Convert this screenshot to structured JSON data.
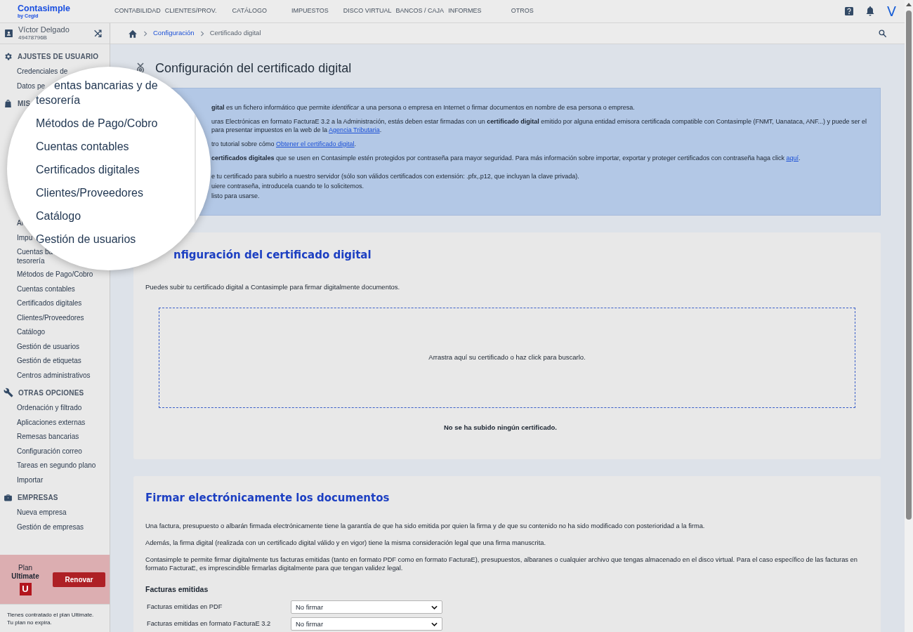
{
  "header": {
    "logo": "Contasimple",
    "logo_sub": "by Cegid",
    "nav": [
      "CONTABILIDAD",
      "CLIENTES/PROV.",
      "CATÁLOGO",
      "IMPUESTOS",
      "DISCO VIRTUAL",
      "BANCOS / CAJA",
      "INFORMES",
      "OTROS"
    ],
    "user_initial": "V"
  },
  "sidebar": {
    "user": {
      "name": "Víctor Delgado",
      "id": "49478796B"
    },
    "sections": [
      {
        "heading": "AJUSTES DE USUARIO",
        "kind": "settings",
        "items": [
          "Credenciales de",
          "Datos pe"
        ]
      },
      {
        "heading": "MIS",
        "kind": "bag"
      },
      {
        "items": [
          "Al",
          "Impu",
          "Cuentas ba\ntesorería",
          "Métodos de Pago/Cobro",
          "Cuentas contables",
          "Certificados digitales",
          "Clientes/Proveedores",
          "Catálogo",
          "Gestión de usuarios",
          "Gestión de etiquetas",
          "Centros administrativos"
        ]
      },
      {
        "heading": "OTRAS OPCIONES",
        "kind": "wrench",
        "items": [
          "Ordenación y filtrado",
          "Aplicaciones externas",
          "Remesas bancarias",
          "Configuración correo",
          "Tareas en segundo plano",
          "Importar"
        ]
      },
      {
        "heading": "EMPRESAS",
        "kind": "briefcase",
        "items": [
          "Nueva empresa",
          "Gestión de empresas"
        ]
      }
    ],
    "plan": {
      "label": "Plan",
      "name": "Ultimate",
      "badge": "U",
      "button": "Renovar"
    },
    "footer": "Tienes contratado el plan Ultimate.\nTu plan no expira."
  },
  "magnifier": {
    "items": [
      "entas bancarias y de",
      "tesorería",
      "Métodos de Pago/Cobro",
      "Cuentas contables",
      "Certificados digitales",
      "Clientes/Proveedores",
      "Catálogo",
      "Gestión de usuarios"
    ]
  },
  "breadcrumb": [
    {
      "label": "Configuración",
      "link": true
    },
    {
      "label": "Certificado digital",
      "link": false
    }
  ],
  "title": "Configuración del certificado digital",
  "info": {
    "paragraphs": [
      [
        {
          "text": "**gital** es un fichero informático que permite *identificar* a una persona o empresa en Internet o firmar documentos en nombre de esa persona o empresa.",
          "link": false
        }
      ],
      [
        {
          "text": "uras Electrónicas en formato FacturaE 3.2 a la Administración, estás deben estar firmadas con un **certificado digital** emitido por alguna entidad emisora certificada compatible con Contasimple (FNMT, Uanataca, ANF...) y puede ser el para presentar impuestos en la web de la ",
          "link": false
        },
        {
          "text": "Agencia Tributaria",
          "link": true
        },
        {
          "text": ".",
          "link": false
        }
      ],
      [
        {
          "text": "tro tutorial sobre cómo ",
          "link": false
        },
        {
          "text": "Obtener el certificado digital",
          "link": true
        },
        {
          "text": ".",
          "link": false
        }
      ],
      [
        {
          "text": "**certificados digitales** que se usen en Contasimple estén protegidos por contraseña para mayor seguridad. Para más información sobre importar, exportar y proteger certificados con contraseña haga click ",
          "link": false
        },
        {
          "text": "aquí",
          "link": true
        },
        {
          "text": ".",
          "link": false
        }
      ]
    ],
    "steps": [
      "e tu certificado para subirlo a nuestro servidor (sólo son válidos certificados con extensión: .pfx,.p12, que incluyan la clave privada).",
      "uiere contraseña, introducela cuando te lo solicitemos.",
      "listo para usarse."
    ]
  },
  "upload_card": {
    "title": "nfiguración del certificado digital",
    "description": "Puedes subir tu certificado digital a Contasimple para firmar digitalmente documentos.",
    "dropzone": "Arrastra aquí su certificado o haz click para buscarlo.",
    "status": "No se ha subido ningún certificado."
  },
  "sign_card": {
    "title": "Firmar electrónicamente los documentos",
    "paragraphs": [
      "Una factura, presupuesto o albarán firmada electrónicamente tiene la garantía de que ha sido emitida por quien la firma y de que su contenido no ha sido modificado con posterioridad a la firma.",
      "Además, la firma digital (realizada con un certificado digital válido y en vigor) tiene la misma consideración legal que una firma manuscrita.",
      "Contasimple te permite firmar digitalmente tus facturas emitidas (tanto en formato PDF como en formato FacturaE), presupuestos, albaranes o cualquier archivo que tengas almacenado en el disco virtual. Para el caso específico de las facturas en formato FacturaE, es imprescindible firmarlas digitalmente para que tengan validez legal."
    ],
    "subheading": "Facturas emitidas",
    "rows": [
      {
        "label": "Facturas emitidas en PDF",
        "value": "No firmar"
      },
      {
        "label": "Facturas emitidas en formato FacturaE 3.2",
        "value": "No firmar"
      }
    ]
  }
}
